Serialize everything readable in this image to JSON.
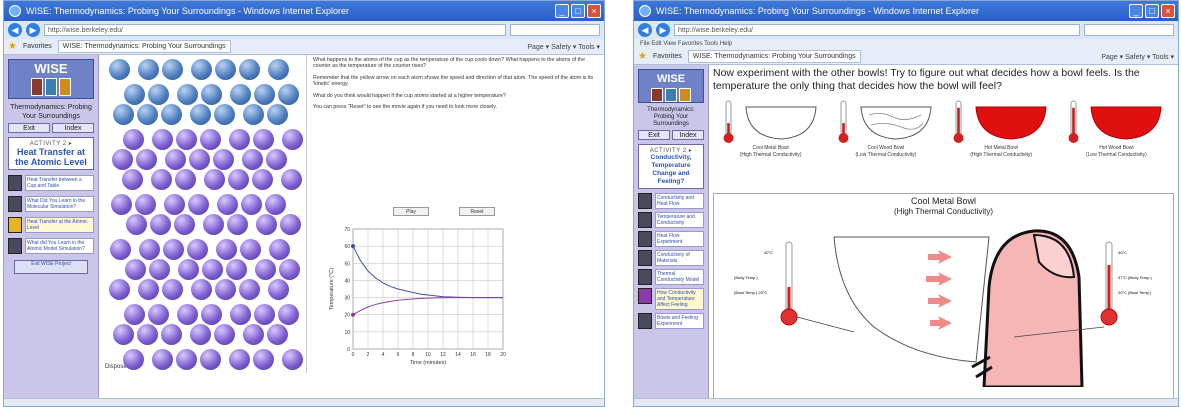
{
  "windows": [
    {
      "title": "WISE: Thermodynamics: Probing Your Surroundings - Windows Internet Explorer",
      "url": "http://wise.berkeley.edu/",
      "tab": "WISE: Thermodynamics: Probing Your Surroundings",
      "favorites": "Favorites",
      "toolbar": "Page ▾   Safety ▾   Tools ▾",
      "sidebar": {
        "logo": "WISE",
        "project": "Thermodynamics: Probing Your Surroundings",
        "exit": "Exit",
        "index": "Index",
        "activity_label": "ACTIVITY 2 ▸",
        "activity": "Heat Transfer at the Atomic Level",
        "steps": [
          "Heat Transfer between a Cup and Table",
          "What Did You Learn in the Molecular Simulation?",
          "Heat Transfer at the Atomic Level",
          "What did You Learn in the Atomic Model Simulation?"
        ],
        "exit_button": "Exit WISE Project"
      },
      "atoms_label": "Dispose",
      "paragraphs": [
        "What happens to the atoms of the cup as the temperature of the cup cools down? What happens to the atoms of the counter as the temperature of the counter rises?",
        "Remember that the yellow arrow on each atom shows the speed and direction of that atom. The speed of the atom is its 'kinetic' energy.",
        "What do you think would happen if the cup atoms started at a higher temperature?",
        "You can press \"Reset\" to see the movie again if you need to look more closely."
      ],
      "buttons": {
        "play": "Play",
        "reset": "Reset"
      },
      "chart_data": {
        "type": "line",
        "title": "",
        "xlabel": "Time (minutes)",
        "ylabel": "Temperature (°C)",
        "xlim": [
          0,
          20
        ],
        "ylim": [
          0,
          70
        ],
        "xticks": [
          0,
          2,
          4,
          6,
          8,
          10,
          12,
          14,
          16,
          18,
          20
        ],
        "yticks": [
          0,
          10,
          20,
          30,
          40,
          50,
          60,
          70
        ],
        "grid": true,
        "series": [
          {
            "color": "#3a4fa0",
            "x": [
              0,
              1,
              2,
              3,
              4,
              5,
              6,
              7,
              8,
              9,
              10,
              11,
              12,
              14,
              16,
              18,
              20
            ],
            "y": [
              60,
              51.5,
              45.5,
              41.5,
              38.5,
              36.5,
              35,
              34,
              33,
              32,
              31.5,
              31,
              30.5,
              30.2,
              30,
              30,
              30
            ]
          },
          {
            "color": "#8a3f9a",
            "x": [
              0,
              1,
              2,
              3,
              4,
              5,
              6,
              7,
              8,
              9,
              10,
              11,
              12,
              14,
              16,
              18,
              20
            ],
            "y": [
              20,
              22.5,
              24.5,
              26,
              27,
              27.8,
              28.4,
              28.9,
              29.2,
              29.5,
              29.7,
              29.8,
              29.9,
              30,
              30,
              30,
              30
            ]
          }
        ]
      }
    },
    {
      "title": "WISE: Thermodynamics: Probing Your Surroundings - Windows Internet Explorer",
      "url": "http://wise.berkeley.edu/",
      "tab": "WISE: Thermodynamics: Probing Your Surroundings",
      "favorites": "Favorites",
      "menu": "File   Edit   View   Favorites   Tools   Help",
      "toolbar": "Page ▾   Safety ▾   Tools ▾",
      "sidebar": {
        "logo": "WISE",
        "project": "Thermodynamics: Probing Your Surroundings",
        "exit": "Exit",
        "index": "Index",
        "activity_label": "ACTIVITY 2 ▸",
        "activity": "Conductivity, Temperature Change and Feeling?",
        "steps": [
          "Conductivity and Heat Flow",
          "Temperature and Conductivity",
          "Heat Flow Experiment",
          "Conductivity of Materials",
          "Thermal Conductivity Model",
          "How Conductivity and Temperature Affect Feeling",
          "Bowls and Feeling Experiment"
        ],
        "exit_button": "Exit WISE Project"
      },
      "question": "Now experiment with the other bowls! Try to figure out what decides how a bowl feels. Is the temperature the only thing that decides how the bowl will feel?",
      "bowls": [
        {
          "name": "Cool Metal Bowl",
          "sub": "(High Thermal Conductivity)",
          "fill": "#ffffff",
          "level": 0.35
        },
        {
          "name": "Cool Wood Bowl",
          "sub": "(Low Thermal Conductivity)",
          "fill": "#ffffff",
          "level": 0.35
        },
        {
          "name": "Hot Metal Bowl",
          "sub": "(High Thermal Conductivity)",
          "fill": "#e01010",
          "level": 0.8
        },
        {
          "name": "Hot Wood Bowl",
          "sub": "(Low Thermal Conductivity)",
          "fill": "#e01010",
          "level": 0.8
        }
      ],
      "diagram": {
        "title": "Cool Metal Bowl",
        "subtitle": "(High Thermal Conductivity)",
        "left_thermo": {
          "top": "40°C",
          "body": "(Body Temp.)",
          "bowl": "(Bowl Temp.) 20°C"
        },
        "right_thermo": {
          "top": "40°C",
          "body": "37°C (Body Temp.)",
          "bowl": "20°C (Bowl Temp.)"
        }
      }
    }
  ]
}
